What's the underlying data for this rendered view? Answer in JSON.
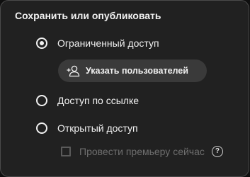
{
  "dialog": {
    "title": "Сохранить или опубликовать"
  },
  "options": [
    {
      "label": "Ограниченный доступ",
      "checked": true
    },
    {
      "label": "Доступ по ссылке",
      "checked": false
    },
    {
      "label": "Открытый доступ",
      "checked": false
    }
  ],
  "specify_users_button": {
    "label": "Указать пользователей",
    "icon": "add-person-icon"
  },
  "premiere": {
    "label": "Провести премьеру сейчас",
    "checked": false,
    "disabled": true,
    "help_glyph": "?"
  },
  "colors": {
    "panel_background": "#212121",
    "panel_border": "#4a4a4a",
    "text_primary": "#f1f1f1",
    "text_disabled": "#6e6e6e",
    "button_background": "#3a3a3a"
  }
}
